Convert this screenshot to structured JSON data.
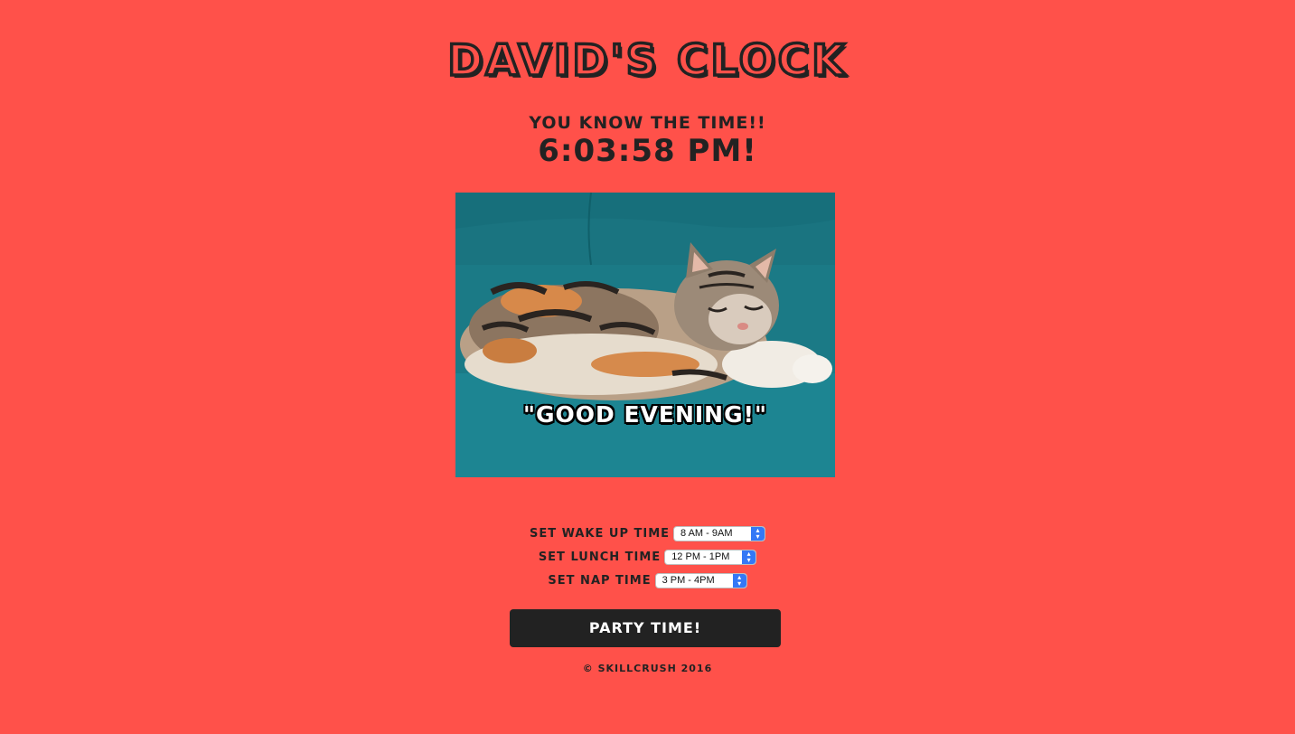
{
  "page": {
    "background_color": "#ff514a",
    "text_color": "#222222",
    "title": "David's Clock",
    "tagline": "You know the time!!",
    "clock_display": "6:03:58 PM!"
  },
  "photo": {
    "caption": "\"GOOD EVENING!\"",
    "subject": "sleeping calico cat on teal couch"
  },
  "controls": {
    "wake_up": {
      "label": "Set Wake Up Time",
      "selected": "8 AM - 9AM"
    },
    "lunch": {
      "label": "Set Lunch Time",
      "selected": "12 PM - 1PM"
    },
    "nap": {
      "label": "Set Nap Time",
      "selected": "3 PM - 4PM"
    },
    "select_accent_color": "#3478f6"
  },
  "party_button": {
    "label": "Party Time!"
  },
  "footer": {
    "text": "© Skillcrush 2016"
  }
}
